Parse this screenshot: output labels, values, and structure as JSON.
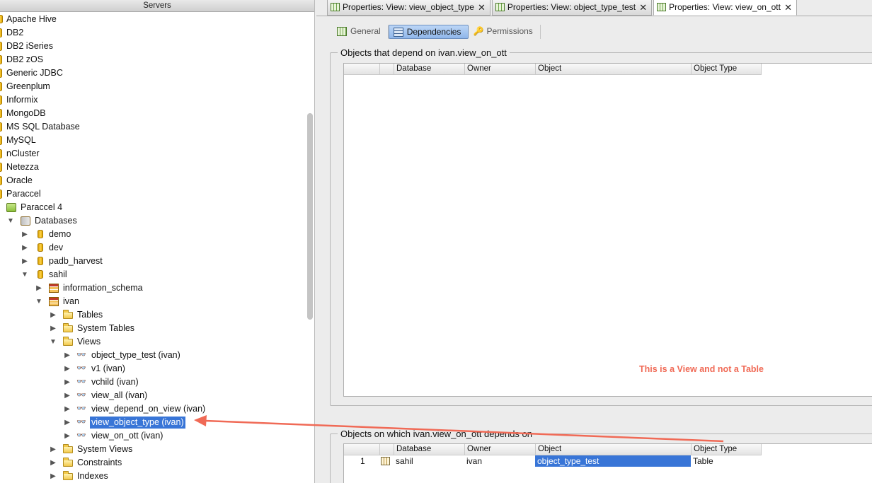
{
  "servers": {
    "title": "Servers",
    "items": [
      {
        "label": "Apache Hive"
      },
      {
        "label": "DB2"
      },
      {
        "label": "DB2 iSeries"
      },
      {
        "label": "DB2 zOS"
      },
      {
        "label": "Generic JDBC"
      },
      {
        "label": "Greenplum"
      },
      {
        "label": "Informix"
      },
      {
        "label": "MongoDB"
      },
      {
        "label": "MS SQL Database"
      },
      {
        "label": "MySQL"
      },
      {
        "label": "nCluster"
      },
      {
        "label": "Netezza"
      },
      {
        "label": "Oracle"
      },
      {
        "label": "Paraccel"
      }
    ],
    "server": {
      "label": "Paraccel 4",
      "icon": "server-icon"
    },
    "databases_label": "Databases",
    "databases": [
      {
        "label": "demo"
      },
      {
        "label": "dev"
      },
      {
        "label": "padb_harvest"
      },
      {
        "label": "sahil"
      }
    ],
    "schemas": [
      {
        "label": "information_schema"
      },
      {
        "label": "ivan"
      }
    ],
    "folders": {
      "tables": "Tables",
      "system_tables": "System Tables",
      "views": "Views",
      "system_views": "System Views",
      "constraints": "Constraints",
      "indexes": "Indexes"
    },
    "views": [
      {
        "label": "object_type_test (ivan)"
      },
      {
        "label": "v1 (ivan)"
      },
      {
        "label": "vchild (ivan)"
      },
      {
        "label": "view_all (ivan)"
      },
      {
        "label": "view_depend_on_view (ivan)"
      },
      {
        "label": "view_object_type (ivan)",
        "selected": true
      },
      {
        "label": "view_on_ott (ivan)"
      }
    ]
  },
  "editor_tabs": [
    {
      "label": "Properties: View: view_object_type",
      "active": false
    },
    {
      "label": "Properties: View: object_type_test",
      "active": false
    },
    {
      "label": "Properties: View: view_on_ott",
      "active": true
    }
  ],
  "close_glyph": "✕",
  "inner_tabs": [
    {
      "label": "General",
      "icon": "general-icon"
    },
    {
      "label": "Dependencies",
      "icon": "dependencies-icon",
      "active": true
    },
    {
      "label": "Permissions",
      "icon": "permissions-icon"
    }
  ],
  "dependents": {
    "title": "Objects that depend on ivan.view_on_ott",
    "columns": [
      "Database",
      "Owner",
      "Object",
      "Object Type"
    ],
    "rows": []
  },
  "dependencies": {
    "title": "Objects on which ivan.view_on_ott depends on",
    "columns": [
      "Database",
      "Owner",
      "Object",
      "Object Type"
    ],
    "rows": [
      {
        "index": "1",
        "database": "sahil",
        "owner": "ivan",
        "object": "object_type_test",
        "object_type": "Table"
      }
    ]
  },
  "annotation": "This is a View and not a Table",
  "colors": {
    "selection": "#3875d7",
    "annotation": "#f06a56"
  }
}
